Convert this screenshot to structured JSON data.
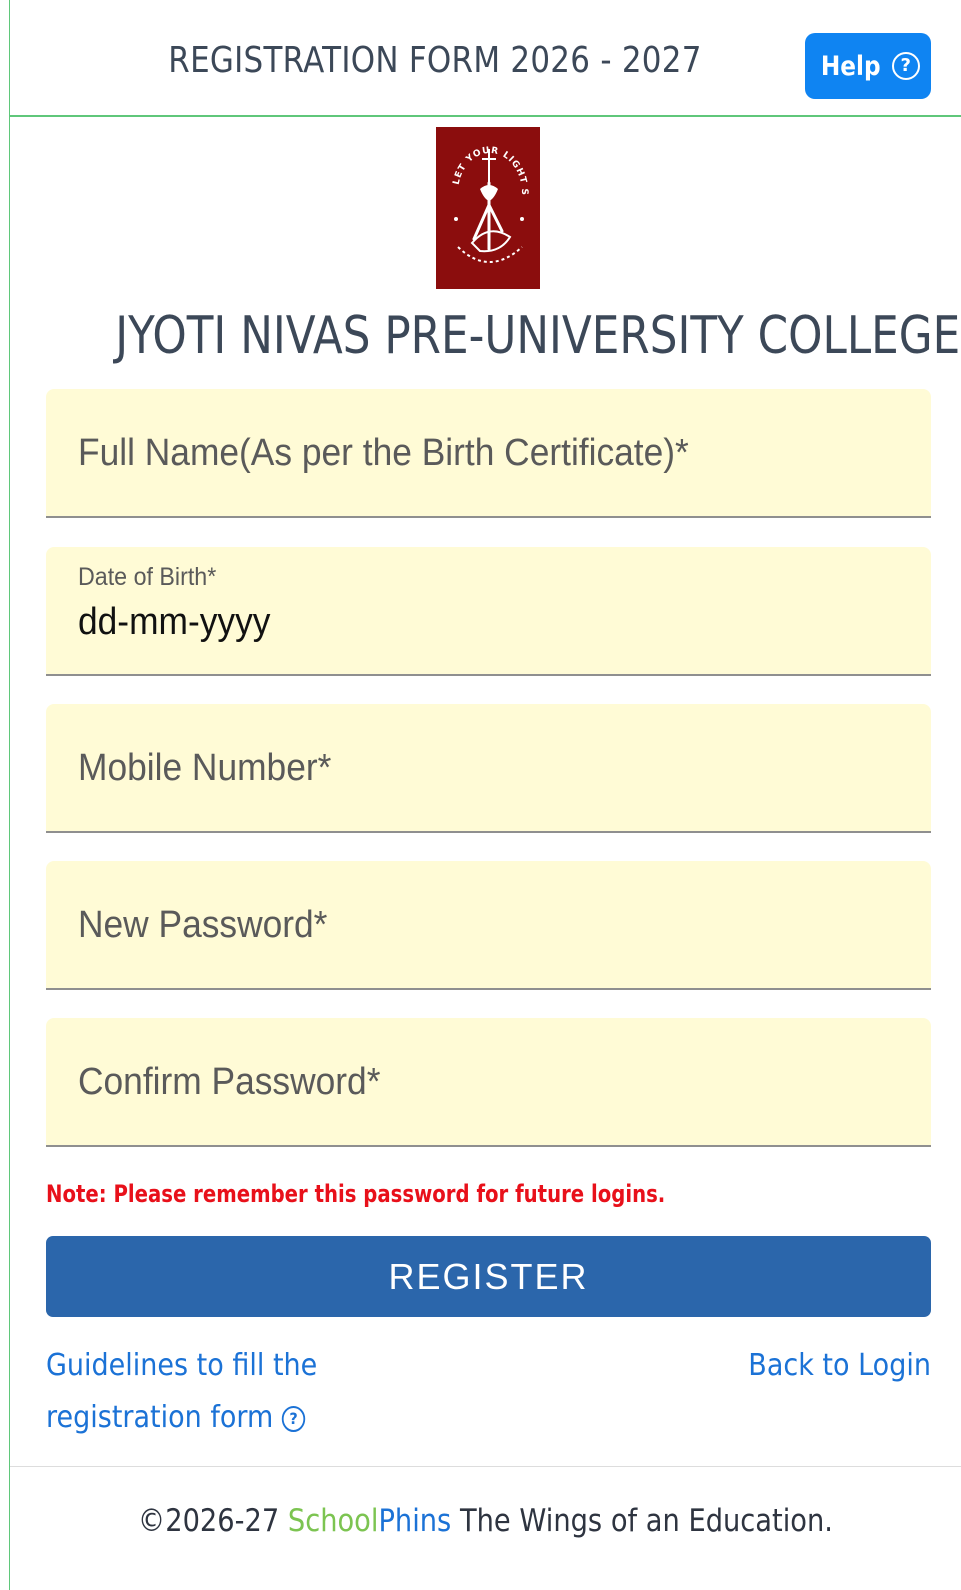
{
  "header": {
    "title": "REGISTRATION FORM 2026 - 2027",
    "help_label": "Help",
    "help_icon": "question-circle-icon"
  },
  "college": {
    "name": "JYOTI NIVAS PRE-UNIVERSITY COLLEGE",
    "logo_motto": "LET YOUR LIGHT SHINE",
    "logo_color": "#8b0d0d"
  },
  "form": {
    "full_name_placeholder": "Full Name(As per the Birth Certificate)*",
    "dob_label": "Date of Birth*",
    "dob_value": "dd-mm-yyyy",
    "mobile_placeholder": "Mobile Number*",
    "new_password_placeholder": "New Password*",
    "confirm_password_placeholder": "Confirm Password*",
    "field_bg": "#fffbd6"
  },
  "note": "Note: Please remember this password for future logins.",
  "register_label": "REGISTER",
  "links": {
    "guidelines_line1": "Guidelines to fill the",
    "guidelines_line2": "registration form",
    "back_to_login": "Back to Login"
  },
  "footer": {
    "copyright": "©2026-27",
    "brand_part1": "School",
    "brand_part2": "Phins",
    "tagline": "The Wings of an Education."
  },
  "colors": {
    "accent_green": "#5fc77a",
    "help_blue": "#0f84f2",
    "register_blue": "#2b66ab",
    "link_blue": "#1b72d6",
    "note_red": "#e8101a"
  }
}
